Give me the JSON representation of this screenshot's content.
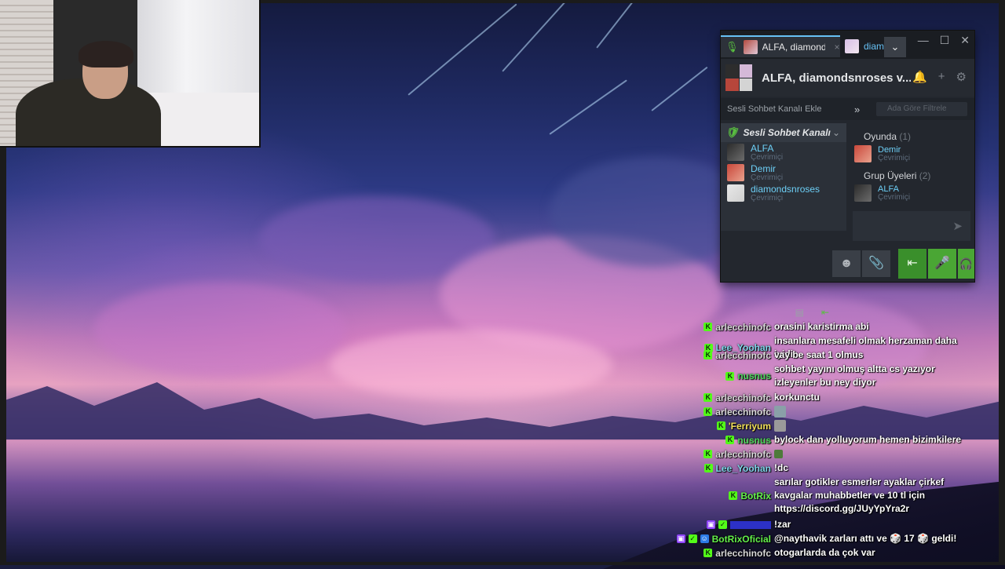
{
  "chat_window": {
    "tabs": [
      {
        "label": "ALFA, diamondsnroses",
        "close": "×"
      },
      {
        "label": "diamondsnroses"
      }
    ],
    "controls": {
      "minimize": "—",
      "maximize": "☐",
      "close": "✕"
    },
    "group_title": "ALFA, diamondsnroses v...",
    "voice_add_label": "Sesli Sohbet Kanalı Ekle",
    "search_placeholder": "Ada Göre Filtrele",
    "voice_channel": {
      "title": "Sesli Sohbet Kanalı",
      "members": [
        {
          "name": "ALFA",
          "status": "Çevrimiçi"
        },
        {
          "name": "Demir",
          "status": "Çevrimiçi"
        },
        {
          "name": "diamondsnroses",
          "status": "Çevrimiçi"
        }
      ]
    },
    "member_list": {
      "in_game_label": "Oyunda",
      "in_game_count": "(1)",
      "in_game": [
        {
          "name": "Demir",
          "status": "Çevrimiçi"
        }
      ],
      "group_label": "Grup Üyeleri",
      "group_count": "(2)",
      "group": [
        {
          "name": "ALFA",
          "status": "Çevrimiçi"
        }
      ]
    },
    "colors": {
      "accent": "#67c1f5",
      "voice_green": "#4aa634",
      "name_blue": "#6dcff6"
    }
  },
  "stream_chat": [
    {
      "user": "arlecchinofc",
      "text": "orasini karistirma abi"
    },
    {
      "user": "Lee_Yoohan",
      "text": "insanlara mesafeli olmak herzaman daha iyidir"
    },
    {
      "user": "arlecchinofc",
      "text": "vay be saat 1 olmus"
    },
    {
      "user": "nusnus",
      "text": "sohbet yayını olmuş altta cs yazıyor izleyenler bu ney diyor"
    },
    {
      "user": "arlecchinofc",
      "text": "korkunctu"
    },
    {
      "user": "arlecchinofc",
      "text": ""
    },
    {
      "user": "'Ferriyum",
      "text": ""
    },
    {
      "user": "nusnus",
      "text": "bylock dan yolluyorum hemen bizimkilere"
    },
    {
      "user": "arlecchinofc",
      "text": ""
    },
    {
      "user": "Lee_Yoohan",
      "text": "!dc"
    },
    {
      "user": "BotRix",
      "text": "sarılar gotikler esmerler ayaklar çirkef kavgalar muhabbetler ve 10 tl için https://discord.gg/JUyYpYra2r"
    },
    {
      "user": "",
      "text": "!zar"
    },
    {
      "user": "BotRixOficial",
      "text": "@naythavik zarları attı ve 🎲 17 🎲 geldi!"
    },
    {
      "user": "arlecchinofc",
      "text": "otogarlarda da çok var"
    }
  ]
}
